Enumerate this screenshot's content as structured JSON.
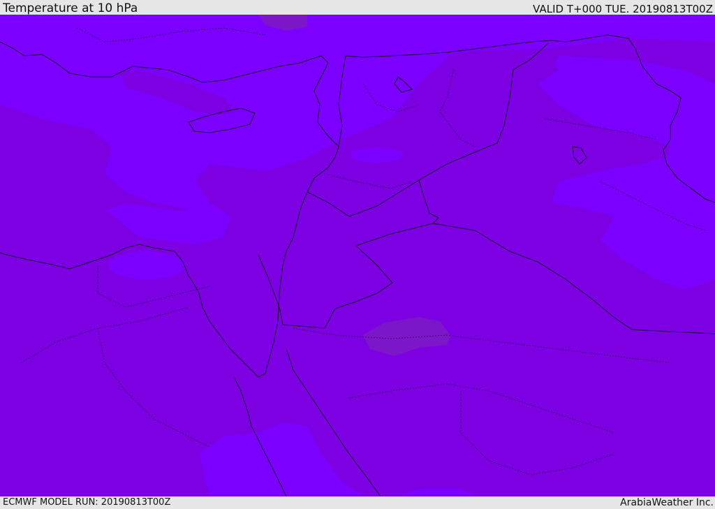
{
  "header": {
    "title": "Temperature at 10 hPa",
    "valid_time": "VALID T+000 TUE. 20190813T00Z"
  },
  "footer": {
    "model_run": "ECMWF MODEL RUN: 20190813T00Z",
    "credit": "ArabiaWeather Inc."
  },
  "colors": {
    "band_light": "#7b00ff",
    "band_mid": "#7c00e2",
    "band_dark": "#7b17c8",
    "coastline": "#1a0033",
    "borders": "#1a0033"
  }
}
